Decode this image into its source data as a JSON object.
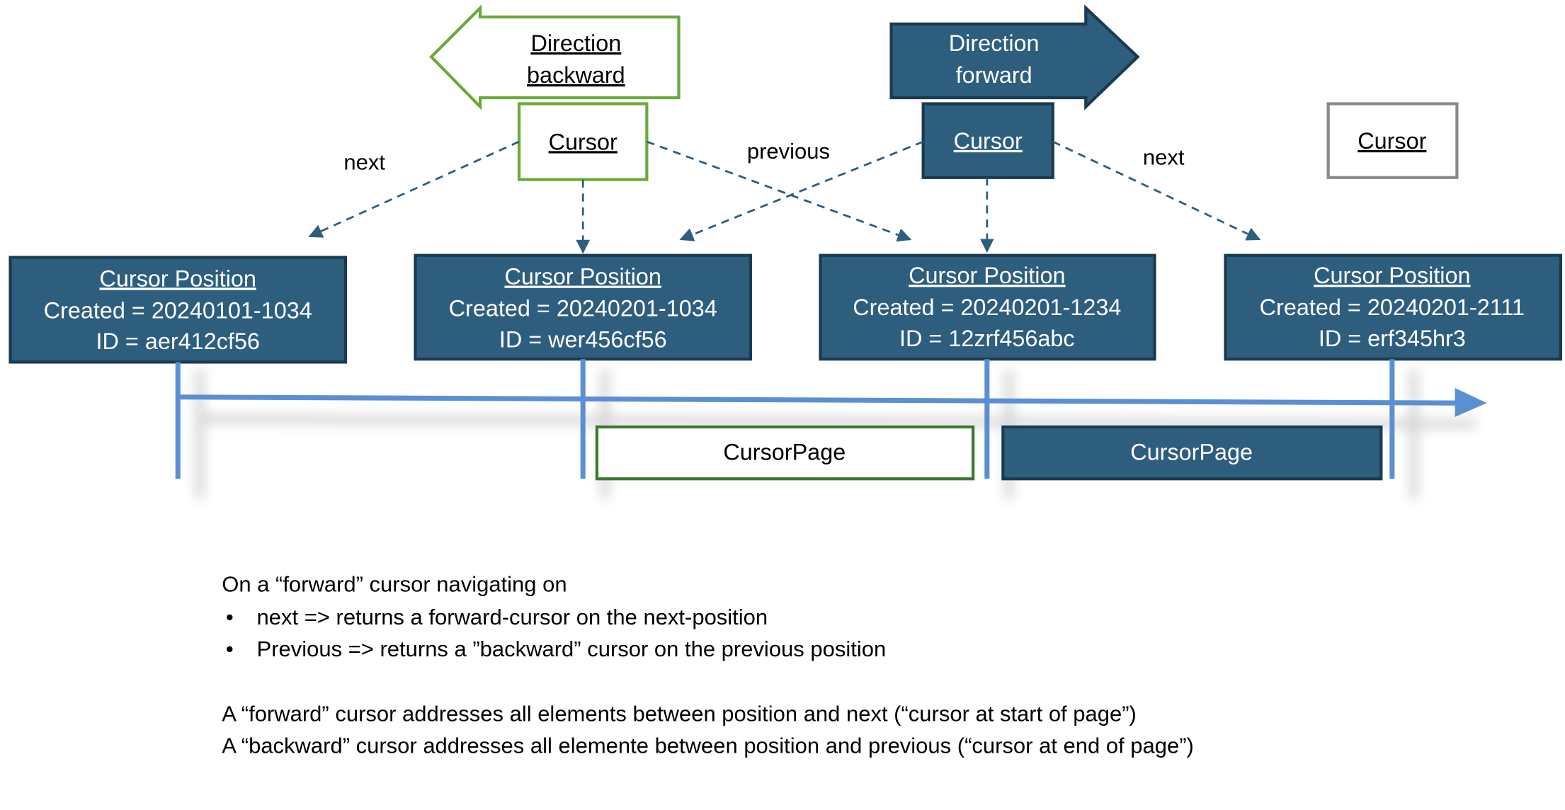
{
  "colors": {
    "primary_fill": "#2e5e7e",
    "dark_stroke": "#1a3a50",
    "backward_green": "#6aaa3a",
    "page_green": "#3a7a30",
    "timeline_blue": "#5b8fd4",
    "inactive_gray": "#8a8a8a"
  },
  "direction_backward": {
    "line1": "Direction",
    "line2": "backward"
  },
  "direction_forward": {
    "line1": "Direction",
    "line2": "forward"
  },
  "cursors": [
    {
      "label": "Cursor",
      "style": "backward"
    },
    {
      "label": "Cursor",
      "style": "forward"
    },
    {
      "label": "Cursor",
      "style": "inactive"
    }
  ],
  "edge_labels": {
    "next_left": "next",
    "previous": "previous",
    "next_right": "next"
  },
  "positions": [
    {
      "title": "Cursor Position",
      "created": "Created = 20240101-1034",
      "id": "ID = aer412cf56"
    },
    {
      "title": "Cursor Position",
      "created": "Created = 20240201-1034",
      "id": "ID = wer456cf56"
    },
    {
      "title": "Cursor Position",
      "created": "Created = 20240201-1234",
      "id": "ID = 12zrf456abc"
    },
    {
      "title": "Cursor Position",
      "created": "Created = 20240201-2111",
      "id": "ID = erf345hr3"
    }
  ],
  "pages": [
    {
      "label": "CursorPage",
      "style": "backward"
    },
    {
      "label": "CursorPage",
      "style": "forward"
    }
  ],
  "notes": {
    "intro": "On a “forward” cursor navigating on",
    "bullets": [
      "next => returns a forward-cursor on the next-position",
      "Previous => returns a ”backward” cursor on the previous position"
    ],
    "bullet_glyph": "•",
    "line1": "A “forward” cursor addresses all elements between position and next (“cursor at start of page”)",
    "line2": "A “backward” cursor addresses all elemente between position and previous (“cursor at end of page”)"
  }
}
